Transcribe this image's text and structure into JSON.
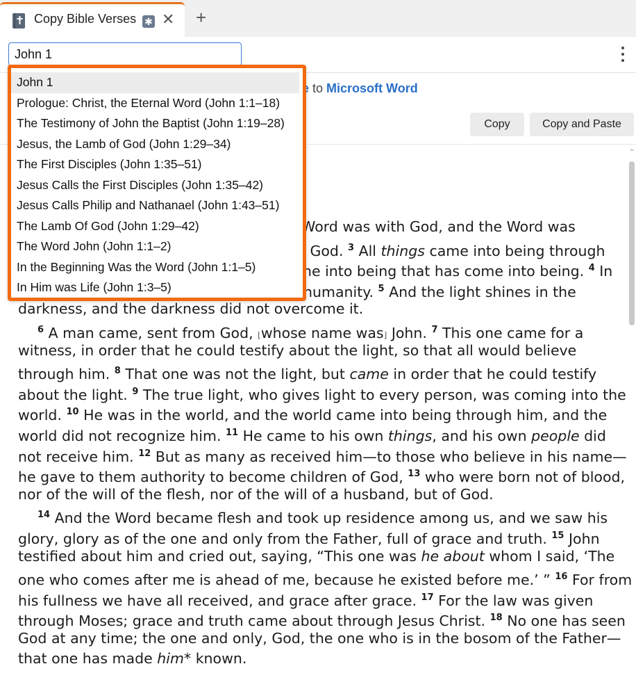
{
  "tab": {
    "title": "Copy Bible Verses",
    "close_glyph": "✕",
    "add_glyph": "+"
  },
  "search": {
    "value": "John 1"
  },
  "copy_info": {
    "source": "le",
    "connector": " to ",
    "destination": "Microsoft Word"
  },
  "buttons": {
    "copy": "Copy",
    "copy_and_paste": "Copy and Paste"
  },
  "dropdown": {
    "items": [
      "John 1",
      "Prologue: Christ, the Eternal Word (John 1:1–18)",
      "The Testimony of John the Baptist (John 1:19–28)",
      "Jesus, the Lamb of God (John 1:29–34)",
      "The First Disciples (John 1:35–51)",
      "Jesus Calls the First Disciples (John 1:35–42)",
      "Jesus Calls Philip and Nathanael (John 1:43–51)",
      "The Lamb Of God (John 1:29–42)",
      "The Word John (John 1:1–2)",
      "In the Beginning Was the Word (John 1:1–5)",
      "In Him was Life (John 1:3–5)"
    ]
  },
  "passage": {
    "l1a": "e Word was with God, and the Word was",
    "l2a": "n God.",
    "v3": "3",
    "l2b": " All ",
    "l2c": "things",
    "l2d": " came into being through",
    "l3a": "me into being that has come into being.",
    "v4": "4",
    "l3b": " In",
    "l4a": "humanity.",
    "v5": "5",
    "l4b": " And the light shines in the",
    "l5": "darkness, and the darkness did not overcome it.",
    "v6": "6",
    "l6a": " A man came, sent from God, ",
    "bo": "⌊",
    "l6b": "whose name was",
    "bc": "⌋",
    "l6c": " John.",
    "v7": "7",
    "l6d": " This one came for a",
    "l7": "witness, in order that he could testify about the light, so that all would believe",
    "l8a": "through him.",
    "v8": "8",
    "l8b": " That one was not the light, but ",
    "l8c": "came",
    "l8d": " in order that he could testify",
    "l9a": "about the light.",
    "v9": "9",
    "l9b": " The true light, who gives light to every person, was coming into the",
    "l10a": "world.",
    "v10": "10",
    "l10b": " He was in the world, and the world came into being through him, and the",
    "l11a": "world did not recognize him.",
    "v11": "11",
    "l11b": " He came to his own ",
    "l11c": "things",
    "l11d": ", and his own ",
    "l11e": "people",
    "l11f": " did",
    "l12a": "not receive him.",
    "v12": "12",
    "l12b": " But as many as received him—to those who believe in his name—",
    "l13a": "he gave to them authority to become children of God,",
    "v13": "13",
    "l13b": " who were born not of blood,",
    "l14": "nor of the will of the flesh, nor of the will of a husband, but of God.",
    "v14": "14",
    "l15a": " And the Word became flesh and took up residence among us, and we saw his",
    "l16a": "glory, glory as of the one and only from the Father, full of grace and truth.",
    "v15": "15",
    "l16b": " John",
    "l17a": "testified about him and cried out, saying, “This one was ",
    "l17b": "he about",
    "l17c": " whom I said, ‘The",
    "l18a": "one who comes after me is ahead of me, because he existed before me.’ ”",
    "v16": "16",
    "l18b": " For from",
    "l19a": "his fullness we have all received, and grace after grace.",
    "v17": "17",
    "l19b": " For the law was given",
    "l20a": "through Moses; grace and truth came about through Jesus Christ.",
    "v18": "18",
    "l20b": " No one has seen",
    "l21": "God at any time; the one and only, God, the one who is in the bosom of the Father—",
    "l22a": "that one has made ",
    "l22b": "him",
    "l22c": "* known."
  }
}
